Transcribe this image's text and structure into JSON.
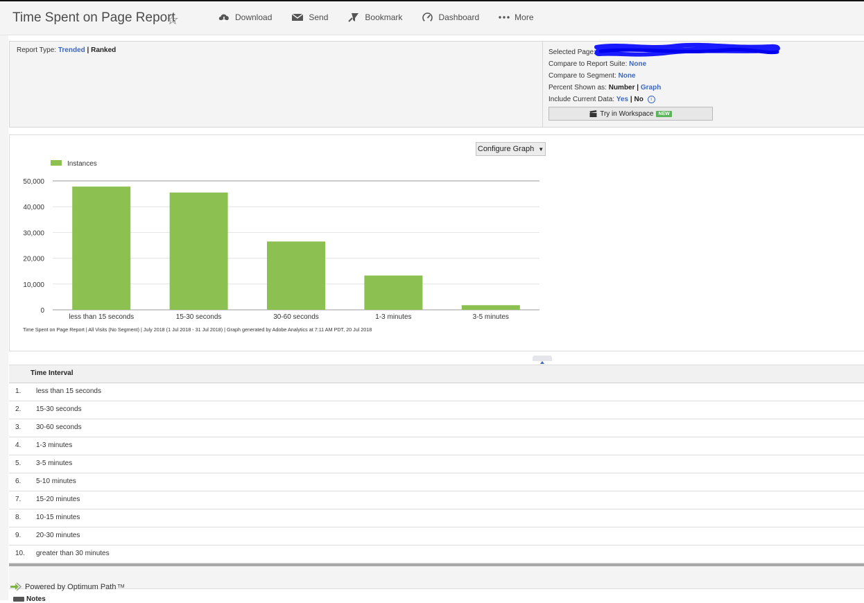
{
  "header": {
    "title": "Time Spent on Page Report",
    "toolbar": [
      {
        "label": "Download",
        "icon": "cloud-download-icon"
      },
      {
        "label": "Send",
        "icon": "envelope-icon"
      },
      {
        "label": "Bookmark",
        "icon": "bookmark-icon"
      },
      {
        "label": "Dashboard",
        "icon": "gauge-icon"
      },
      {
        "label": "More",
        "icon": "more-dots-icon"
      }
    ]
  },
  "settings": {
    "report_type_label": "Report Type:",
    "trended": "Trended",
    "separator": "|",
    "ranked": "Ranked",
    "selected_page_label": "Selected Page:",
    "compare_suite_label": "Compare to Report Suite:",
    "compare_suite_value": "None",
    "compare_segment_label": "Compare to Segment:",
    "compare_segment_value": "None",
    "percent_label": "Percent Shown as:",
    "percent_number": "Number",
    "percent_graph": "Graph",
    "include_label": "Include Current Data:",
    "include_yes": "Yes",
    "include_no": "No",
    "workspace_button": "Try in Workspace",
    "new_badge": "NEW"
  },
  "graph": {
    "configure_button": "Configure Graph",
    "caption": "Time Spent on Page Report | All Visits (No Segment) | July 2018 (1 Jul 2018 - 31 Jul 2018) | Graph generated by Adobe Analytics at  7:11 AM PDT, 20 Jul 2018"
  },
  "chart_data": {
    "type": "bar",
    "categories": [
      "less than 15 seconds",
      "15-30 seconds",
      "30-60 seconds",
      "1-3 minutes",
      "3-5 minutes"
    ],
    "series": [
      {
        "name": "Instances",
        "values": [
          47800,
          45500,
          26500,
          13300,
          1800
        ],
        "color": "#8cc152"
      }
    ],
    "ylim": [
      0,
      50000
    ],
    "yticks": [
      "0",
      "10,000",
      "20,000",
      "30,000",
      "40,000",
      "50,000"
    ],
    "ytick_values": [
      0,
      10000,
      20000,
      30000,
      40000,
      50000
    ],
    "grid": true,
    "legend": "top-left"
  },
  "table": {
    "column_header": "Time Interval",
    "rows": [
      {
        "num": "1.",
        "label": "less than 15 seconds"
      },
      {
        "num": "2.",
        "label": "15-30 seconds"
      },
      {
        "num": "3.",
        "label": "30-60 seconds"
      },
      {
        "num": "4.",
        "label": "1-3 minutes"
      },
      {
        "num": "5.",
        "label": "3-5 minutes"
      },
      {
        "num": "6.",
        "label": "5-10 minutes"
      },
      {
        "num": "7.",
        "label": "15-20 minutes"
      },
      {
        "num": "8.",
        "label": "10-15 minutes"
      },
      {
        "num": "9.",
        "label": "20-30 minutes"
      },
      {
        "num": "10.",
        "label": "greater than 30 minutes"
      }
    ]
  },
  "footer": {
    "powered_by": "Powered by Optimum Path",
    "trademark": "TM",
    "note": "Notes"
  }
}
